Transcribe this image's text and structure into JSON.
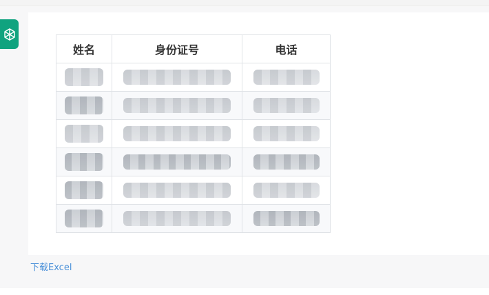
{
  "table": {
    "headers": [
      "姓名",
      "身份证号",
      "电话"
    ],
    "rows": [
      {
        "name": "",
        "id_number": "",
        "phone": ""
      },
      {
        "name": "",
        "id_number": "",
        "phone": ""
      },
      {
        "name": "",
        "id_number": "",
        "phone": ""
      },
      {
        "name": "",
        "id_number": "",
        "phone": ""
      },
      {
        "name": "",
        "id_number": "",
        "phone": ""
      },
      {
        "name": "",
        "id_number": "",
        "phone": ""
      }
    ]
  },
  "download_link": "下载Excel",
  "icons": {
    "assistant_avatar": "chatgpt-logo-icon"
  },
  "colors": {
    "avatar_bg": "#10a37f",
    "link": "#4a90d9"
  }
}
